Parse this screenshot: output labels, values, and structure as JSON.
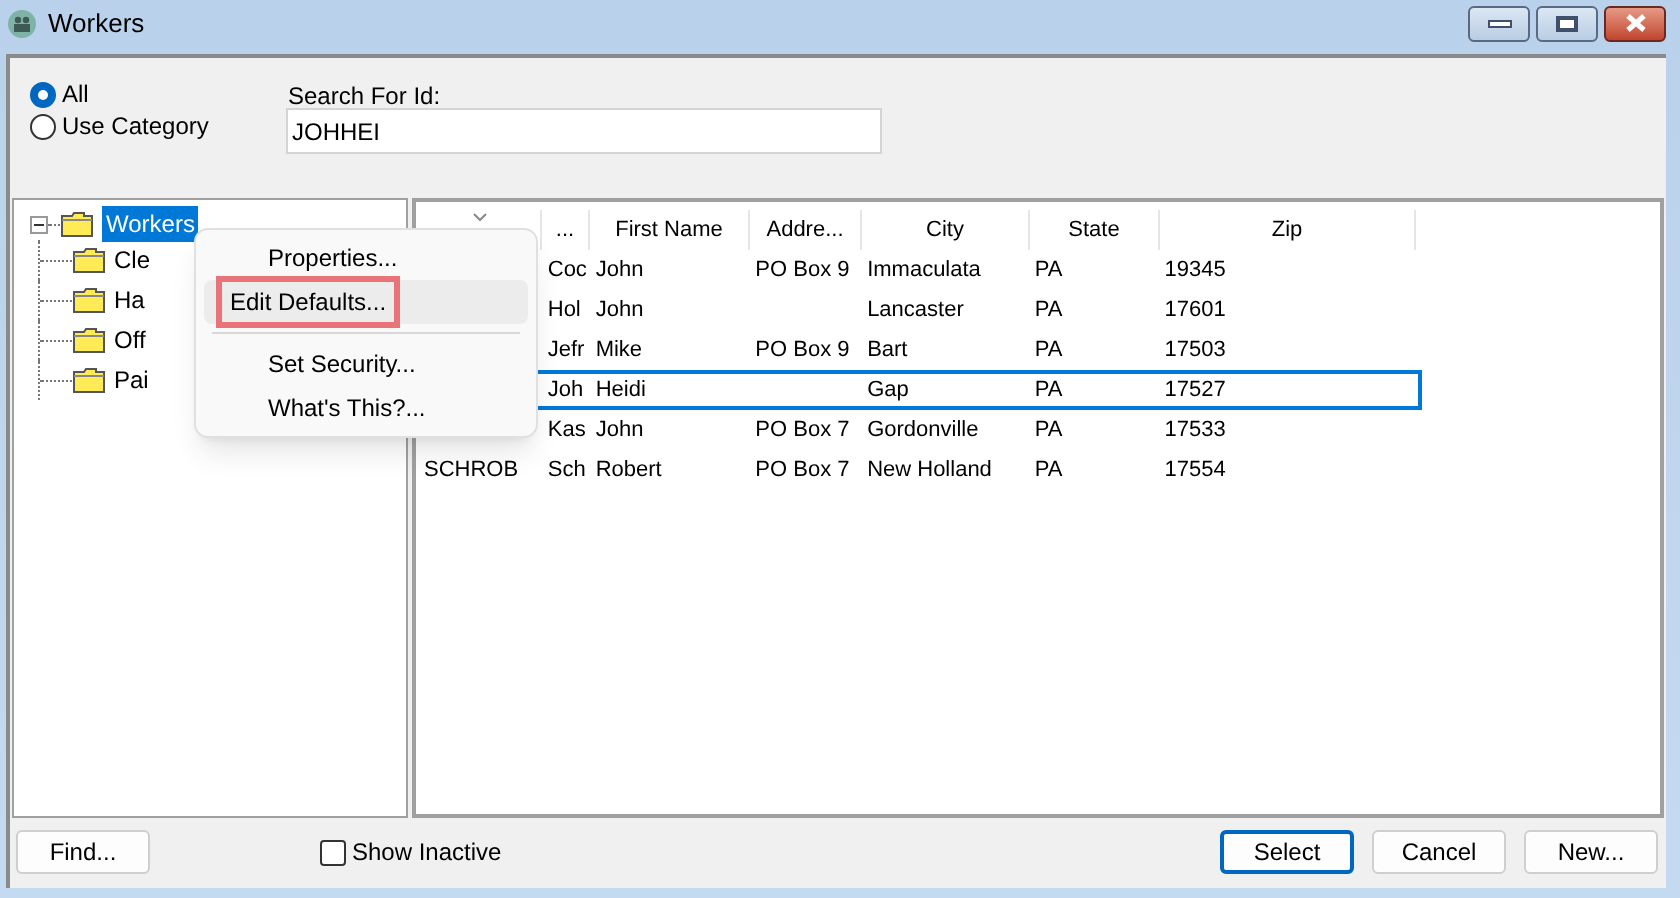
{
  "window": {
    "title": "Workers"
  },
  "filter": [
    {
      "label": "All",
      "selected": true
    },
    {
      "label": "Use Category",
      "selected": false
    }
  ],
  "search": {
    "label": "Search For Id:",
    "value": "JOHHEI"
  },
  "tree": {
    "label": "Workers",
    "selected": true,
    "expanded": true,
    "children": [
      {
        "label": "Cle"
      },
      {
        "label": "Ha"
      },
      {
        "label": "Off"
      },
      {
        "label": "Pai"
      }
    ]
  },
  "context_menu": [
    {
      "label": "Properties...",
      "highlighted": false
    },
    {
      "label": "Edit Defaults...",
      "highlighted": true
    },
    {
      "kind": "separator"
    },
    {
      "label": "Set Security...",
      "highlighted": false
    },
    {
      "label": "What's This?...",
      "highlighted": false
    }
  ],
  "table": {
    "columns": [
      "",
      "...",
      "First Name",
      "Addre...",
      "City",
      "State",
      "Zip"
    ],
    "rows": [
      {
        "cells": [
          "",
          "Coc",
          "John",
          "PO Box 9",
          "Immaculata",
          "PA",
          "19345"
        ],
        "selected": false
      },
      {
        "cells": [
          "",
          "Hol",
          "John",
          "",
          "Lancaster",
          "PA",
          "17601"
        ],
        "selected": false
      },
      {
        "cells": [
          "",
          "Jefr",
          "Mike",
          "PO Box 9",
          "Bart",
          "PA",
          "17503"
        ],
        "selected": false
      },
      {
        "cells": [
          "",
          "Joh",
          "Heidi",
          "",
          "Gap",
          "PA",
          "17527"
        ],
        "selected": true
      },
      {
        "cells": [
          "",
          "Kas",
          "John",
          "PO Box 7",
          "Gordonville",
          "PA",
          "17533"
        ],
        "selected": false
      },
      {
        "cells": [
          "SCHROB",
          "Sch",
          "Robert",
          "PO Box 7",
          "New Holland",
          "PA",
          "17554"
        ],
        "selected": false
      }
    ]
  },
  "show_inactive": {
    "label": "Show Inactive",
    "checked": false
  },
  "buttons": [
    {
      "label": "Find...",
      "default": false
    },
    {
      "label": "Select",
      "default": true
    },
    {
      "label": "Cancel",
      "default": false
    },
    {
      "label": "New...",
      "default": false
    }
  ]
}
